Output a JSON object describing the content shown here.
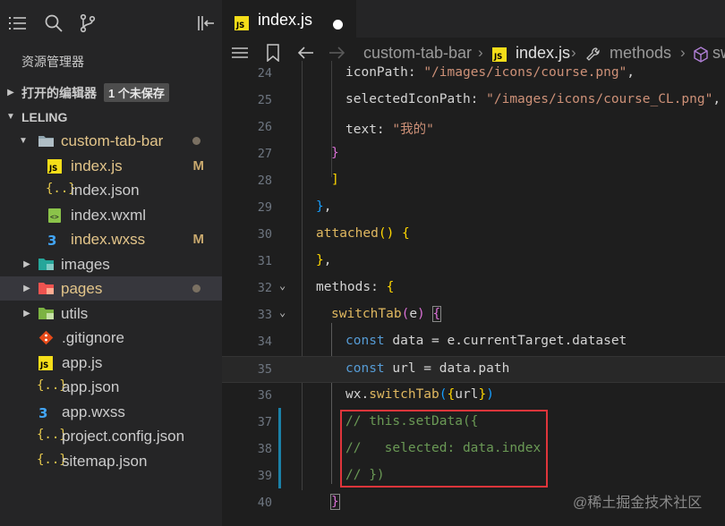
{
  "sidebar": {
    "explorer_title": "资源管理器",
    "open_editors": {
      "label": "打开的编辑器",
      "badge": "1 个未保存"
    },
    "workspace": "LELING",
    "tree": [
      {
        "name": "custom-tab-bar",
        "type": "folder",
        "status": "dot"
      },
      {
        "name": "index.js",
        "type": "js",
        "status": "M"
      },
      {
        "name": "index.json",
        "type": "json",
        "status": ""
      },
      {
        "name": "index.wxml",
        "type": "wxml",
        "status": ""
      },
      {
        "name": "index.wxss",
        "type": "css",
        "status": "M"
      },
      {
        "name": "images",
        "type": "folder",
        "status": ""
      },
      {
        "name": "pages",
        "type": "folder",
        "status": "dot"
      },
      {
        "name": "utils",
        "type": "folder",
        "status": ""
      },
      {
        "name": ".gitignore",
        "type": "git",
        "status": ""
      },
      {
        "name": "app.js",
        "type": "js",
        "status": ""
      },
      {
        "name": "app.json",
        "type": "json",
        "status": ""
      },
      {
        "name": "app.wxss",
        "type": "css",
        "status": ""
      },
      {
        "name": "project.config.json",
        "type": "json",
        "status": ""
      },
      {
        "name": "sitemap.json",
        "type": "json",
        "status": ""
      }
    ]
  },
  "editor": {
    "tab": {
      "label": "index.js",
      "icon": "JS"
    },
    "breadcrumb": {
      "folder": "custom-tab-bar",
      "file": "index.js",
      "symbol": "methods",
      "next": "sw"
    },
    "lines": [
      {
        "n": "24",
        "text": "iconPath: \"/images/icons/course.png\","
      },
      {
        "n": "25",
        "text": "selectedIconPath: \"/images/icons/course_CL.png\","
      },
      {
        "n": "26",
        "text": "text: \"我的\""
      },
      {
        "n": "27",
        "text": "}"
      },
      {
        "n": "28",
        "text": "]"
      },
      {
        "n": "29",
        "text": "},"
      },
      {
        "n": "30",
        "text": "attached() {"
      },
      {
        "n": "31",
        "text": "},"
      },
      {
        "n": "32",
        "text": "methods: {"
      },
      {
        "n": "33",
        "text": "switchTab(e) {"
      },
      {
        "n": "34",
        "text": "const data = e.currentTarget.dataset"
      },
      {
        "n": "35",
        "text": "const url = data.path"
      },
      {
        "n": "36",
        "text": "wx.switchTab({url})"
      },
      {
        "n": "37",
        "text": "// this.setData({"
      },
      {
        "n": "38",
        "text": "//   selected: data.index"
      },
      {
        "n": "39",
        "text": "// })"
      },
      {
        "n": "40",
        "text": "}"
      }
    ]
  },
  "watermark": "@稀土掘金技术社区",
  "colors": {
    "accent_m": "#c9a96e",
    "highlight_box": "#e0353b",
    "js_icon": "#f5de19"
  }
}
